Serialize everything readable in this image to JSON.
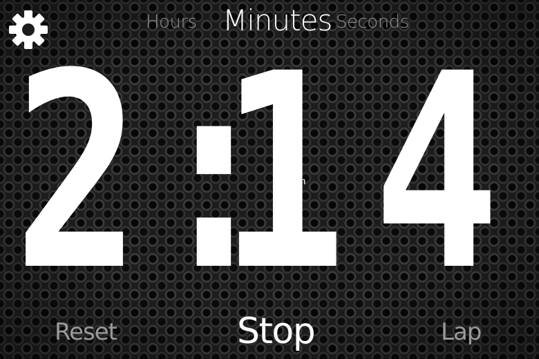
{
  "header": {
    "settings_icon": "gear-icon",
    "units": {
      "hours": "Hours",
      "minutes": "Minutes",
      "seconds": "Seconds",
      "selected": "Minutes"
    }
  },
  "display": {
    "minutes": "2",
    "separator": ":",
    "seconds_tens": "1",
    "seconds_ones": "4"
  },
  "watermark": ".com",
  "controls": {
    "reset_label": "Reset",
    "stop_label": "Stop",
    "lap_label": "Lap"
  },
  "colors": {
    "background": "#1c1c1c",
    "primary_text": "#ffffff",
    "secondary_text": "#8f8f8f"
  }
}
